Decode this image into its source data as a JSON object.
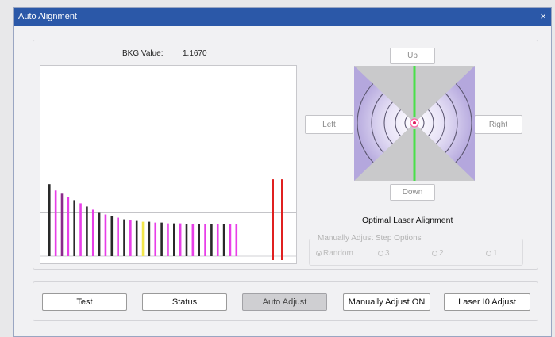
{
  "window": {
    "title": "Auto Alignment",
    "close_glyph": "×"
  },
  "bkg": {
    "label": "BKG Value:",
    "value": "1.1670"
  },
  "directions": {
    "up": "Up",
    "down": "Down",
    "left": "Left",
    "right": "Right"
  },
  "alignment_label": "Optimal Laser Alignment",
  "step_options": {
    "legend": "Manually Adjust Step Options",
    "options": [
      "Random",
      "3",
      "2",
      "1"
    ],
    "selected": "Random"
  },
  "buttons": {
    "test": "Test",
    "status": "Status",
    "auto_adjust": "Auto Adjust",
    "manual_adjust": "Manually Adjust ON",
    "laser_adjust": "Laser I0 Adjust"
  },
  "colors": {
    "black_bar": "#2a2a2a",
    "magenta_bar": "#e83ee8",
    "purple_bar": "#8a2a8a",
    "yellow_bar": "#f2e64a",
    "red_bar": "#e02020",
    "green_beam": "#49e04a",
    "side_purple": "#a898d8",
    "titlebar": "#2b58a8"
  },
  "chart_data": {
    "type": "bar",
    "bars": [
      {
        "value": 0.9,
        "color": "black"
      },
      {
        "value": 0.82,
        "color": "magenta"
      },
      {
        "value": 0.78,
        "color": "purple"
      },
      {
        "value": 0.74,
        "color": "magenta"
      },
      {
        "value": 0.7,
        "color": "black"
      },
      {
        "value": 0.66,
        "color": "magenta"
      },
      {
        "value": 0.62,
        "color": "black"
      },
      {
        "value": 0.58,
        "color": "magenta"
      },
      {
        "value": 0.55,
        "color": "black"
      },
      {
        "value": 0.52,
        "color": "magenta"
      },
      {
        "value": 0.5,
        "color": "black"
      },
      {
        "value": 0.48,
        "color": "magenta"
      },
      {
        "value": 0.46,
        "color": "black"
      },
      {
        "value": 0.45,
        "color": "magenta"
      },
      {
        "value": 0.44,
        "color": "black"
      },
      {
        "value": 0.43,
        "color": "yellow"
      },
      {
        "value": 0.43,
        "color": "black"
      },
      {
        "value": 0.42,
        "color": "magenta"
      },
      {
        "value": 0.42,
        "color": "black"
      },
      {
        "value": 0.41,
        "color": "magenta"
      },
      {
        "value": 0.41,
        "color": "black"
      },
      {
        "value": 0.41,
        "color": "magenta"
      },
      {
        "value": 0.4,
        "color": "black"
      },
      {
        "value": 0.4,
        "color": "magenta"
      },
      {
        "value": 0.4,
        "color": "black"
      },
      {
        "value": 0.4,
        "color": "magenta"
      },
      {
        "value": 0.4,
        "color": "black"
      },
      {
        "value": 0.4,
        "color": "magenta"
      },
      {
        "value": 0.4,
        "color": "black"
      },
      {
        "value": 0.4,
        "color": "magenta"
      },
      {
        "value": 0.4,
        "color": "magenta"
      }
    ],
    "threshold_markers": [
      {
        "value": 0.96,
        "color": "red"
      },
      {
        "value": 0.96,
        "color": "red"
      }
    ],
    "reference_line": 0.55,
    "ylim": [
      0,
      2.2
    ],
    "grid": false
  }
}
